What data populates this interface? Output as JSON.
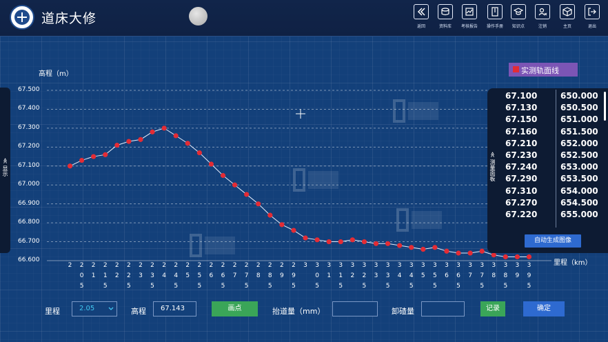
{
  "app": {
    "title": "道床大修"
  },
  "toolbar": {
    "items": [
      {
        "label": "返回",
        "icon": "double-chevron-left-icon"
      },
      {
        "label": "资料库",
        "icon": "database-icon"
      },
      {
        "label": "考核报告",
        "icon": "report-icon"
      },
      {
        "label": "操作手册",
        "icon": "manual-icon"
      },
      {
        "label": "知识点",
        "icon": "graduation-cap-icon"
      },
      {
        "label": "注销",
        "icon": "user-logout-icon"
      },
      {
        "label": "主页",
        "icon": "cube-home-icon"
      },
      {
        "label": "退出",
        "icon": "exit-icon"
      }
    ]
  },
  "left_tab": {
    "label": "≪ 显示"
  },
  "side_panel": {
    "handle_label": "≪ 测量面板",
    "rows": [
      {
        "a": "67.100",
        "b": "650.000"
      },
      {
        "a": "67.130",
        "b": "650.500"
      },
      {
        "a": "67.150",
        "b": "651.000"
      },
      {
        "a": "67.160",
        "b": "651.500"
      },
      {
        "a": "67.210",
        "b": "652.000"
      },
      {
        "a": "67.230",
        "b": "652.500"
      },
      {
        "a": "67.240",
        "b": "653.000"
      },
      {
        "a": "67.290",
        "b": "653.500"
      },
      {
        "a": "67.310",
        "b": "654.000"
      },
      {
        "a": "67.270",
        "b": "654.500"
      },
      {
        "a": "67.220",
        "b": "655.000"
      }
    ],
    "auto_button": "自动生成图像"
  },
  "form": {
    "mileage_label": "里程",
    "mileage_value": "2.05",
    "elevation_label": "高程",
    "elevation_value": "67.143",
    "draw_button": "画点",
    "lift_label": "抬道量（mm）",
    "lift_value": "",
    "unload_label": "卸碴量",
    "unload_value": "",
    "record_button": "记录",
    "confirm_button": "确定"
  },
  "colors": {
    "series": "#e32c35",
    "line": "#e8eefc",
    "legend_bg": "#7c55b5"
  },
  "chart_data": {
    "type": "line",
    "ylabel": "高程（m）",
    "xlabel": "里程（km）",
    "ylim": [
      66.6,
      67.5
    ],
    "y_ticks": [
      "67.500",
      "67.400",
      "67.300",
      "67.200",
      "67.100",
      "67.000",
      "66.900",
      "66.800",
      "66.700",
      "66.600"
    ],
    "x_ticks": [
      "2",
      "2.05",
      "2.1",
      "2.15",
      "2.2",
      "2.25",
      "2.3",
      "2.35",
      "2.4",
      "2.45",
      "2.5",
      "2.55",
      "2.6",
      "2.65",
      "2.7",
      "2.75",
      "2.8",
      "2.85",
      "2.9",
      "2.95",
      "3",
      "3.05",
      "3.1",
      "3.15",
      "3.2",
      "3.25",
      "3.3",
      "3.35",
      "3.4",
      "3.45",
      "3.5",
      "3.55",
      "3.6",
      "3.65",
      "3.7",
      "3.75",
      "3.8",
      "3.85",
      "3.9",
      "3.95"
    ],
    "x_tick_rows": [
      [
        "2",
        "",
        ""
      ],
      [
        "2",
        "0",
        "5"
      ],
      [
        "2",
        "1",
        ""
      ],
      [
        "2",
        "1",
        "5"
      ],
      [
        "2",
        "2",
        ""
      ],
      [
        "2",
        "2",
        "5"
      ],
      [
        "2",
        "3",
        ""
      ],
      [
        "2",
        "3",
        "5"
      ],
      [
        "2",
        "4",
        ""
      ],
      [
        "2",
        "4",
        "5"
      ],
      [
        "2",
        "5",
        ""
      ],
      [
        "2",
        "5",
        "5"
      ],
      [
        "2",
        "6",
        ""
      ],
      [
        "2",
        "6",
        "5"
      ],
      [
        "2",
        "7",
        ""
      ],
      [
        "2",
        "7",
        "5"
      ],
      [
        "2",
        "8",
        ""
      ],
      [
        "2",
        "8",
        "5"
      ],
      [
        "2",
        "9",
        ""
      ],
      [
        "2",
        "9",
        "5"
      ],
      [
        "3",
        "",
        ""
      ],
      [
        "3",
        "0",
        "5"
      ],
      [
        "3",
        "1",
        ""
      ],
      [
        "3",
        "1",
        "5"
      ],
      [
        "3",
        "2",
        ""
      ],
      [
        "3",
        "2",
        "5"
      ],
      [
        "3",
        "3",
        ""
      ],
      [
        "3",
        "3",
        "5"
      ],
      [
        "3",
        "4",
        ""
      ],
      [
        "3",
        "4",
        "5"
      ],
      [
        "3",
        "5",
        ""
      ],
      [
        "3",
        "5",
        "5"
      ],
      [
        "3",
        "6",
        ""
      ],
      [
        "3",
        "6",
        "5"
      ],
      [
        "3",
        "7",
        ""
      ],
      [
        "3",
        "7",
        "5"
      ],
      [
        "3",
        "8",
        ""
      ],
      [
        "3",
        "8",
        "5"
      ],
      [
        "3",
        "9",
        ""
      ],
      [
        "3",
        "9",
        "5"
      ]
    ],
    "series": [
      {
        "name": "实测轨面线",
        "x": [
          2,
          2.05,
          2.1,
          2.15,
          2.2,
          2.25,
          2.3,
          2.35,
          2.4,
          2.45,
          2.5,
          2.55,
          2.6,
          2.65,
          2.7,
          2.75,
          2.8,
          2.85,
          2.9,
          2.95,
          3,
          3.05,
          3.1,
          3.15,
          3.2,
          3.25,
          3.3,
          3.35,
          3.4,
          3.45,
          3.5,
          3.55,
          3.6,
          3.65,
          3.7,
          3.75,
          3.8,
          3.85,
          3.9,
          3.95
        ],
        "y": [
          67.1,
          67.13,
          67.15,
          67.16,
          67.21,
          67.23,
          67.24,
          67.28,
          67.3,
          67.26,
          67.22,
          67.17,
          67.11,
          67.05,
          67.0,
          66.95,
          66.9,
          66.84,
          66.79,
          66.76,
          66.72,
          66.71,
          66.7,
          66.7,
          66.71,
          66.7,
          66.69,
          66.69,
          66.68,
          66.67,
          66.66,
          66.67,
          66.65,
          66.64,
          66.64,
          66.65,
          66.63,
          66.62,
          66.62,
          66.62
        ]
      }
    ],
    "legend": "top-right",
    "grid": true
  }
}
